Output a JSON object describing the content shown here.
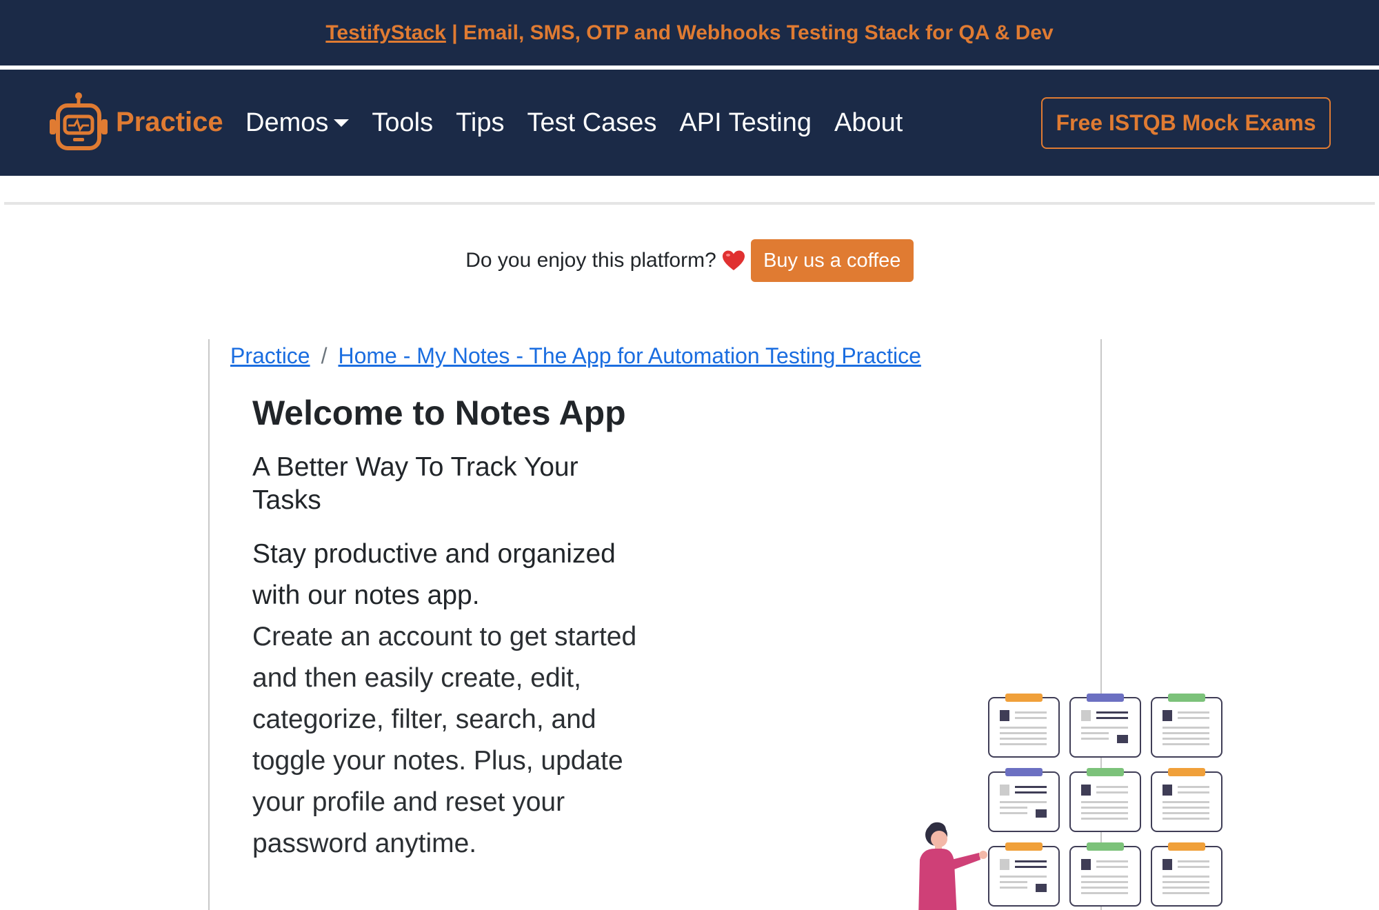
{
  "topbar": {
    "link_text": "TestifyStack",
    "rest_text": " | Email, SMS, OTP and Webhooks Testing Stack for QA & Dev"
  },
  "navbar": {
    "brand": "Practice",
    "items": [
      {
        "label": "Demos"
      },
      {
        "label": "Tools"
      },
      {
        "label": "Tips"
      },
      {
        "label": "Test Cases"
      },
      {
        "label": "API Testing"
      },
      {
        "label": "About"
      }
    ],
    "cta": "Free ISTQB Mock Exams"
  },
  "support": {
    "question": "Do you enjoy this platform?",
    "button": "Buy us a coffee"
  },
  "breadcrumb": {
    "root": "Practice",
    "separator": "/",
    "current": "Home - My Notes - The App for Automation Testing Practice"
  },
  "main": {
    "title": "Welcome to Notes App",
    "subtitle": "A Better Way To Track Your Tasks",
    "lead": "Stay productive and organized with our notes app.",
    "description": "Create an account to get started and then easily create, edit, categorize, filter, search, and toggle your notes. Plus, update your profile and reset your password anytime."
  },
  "colors": {
    "navy": "#1b2a47",
    "orange": "#e07b32",
    "link": "#1a6de0"
  }
}
